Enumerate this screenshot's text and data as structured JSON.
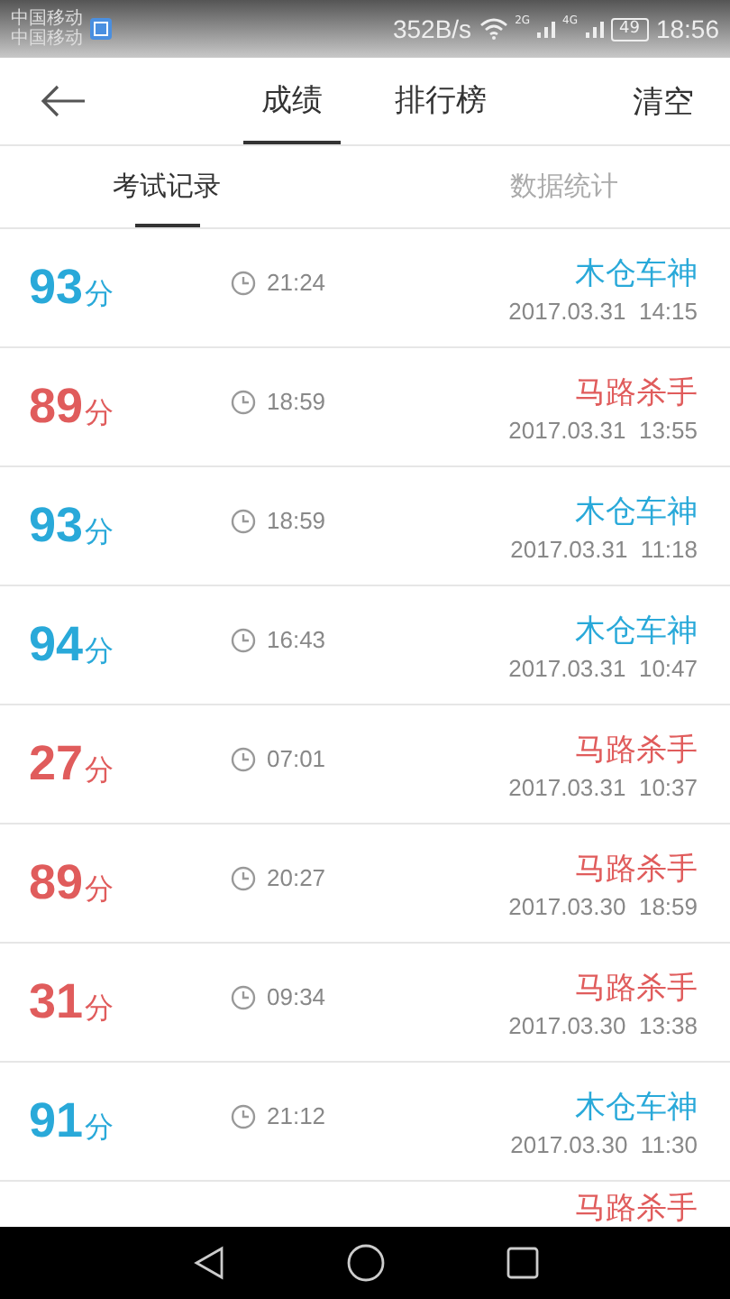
{
  "status_bar": {
    "carrier_1": "中国移动",
    "carrier_2": "中国移动",
    "speed": "352B/s",
    "network_1": "2G",
    "network_2": "4G",
    "battery": "49",
    "time": "18:56"
  },
  "header": {
    "tabs": [
      {
        "label": "成绩",
        "selected": true
      },
      {
        "label": "排行榜",
        "selected": false
      }
    ],
    "action": "清空"
  },
  "subtabs": [
    {
      "label": "考试记录",
      "selected": true
    },
    {
      "label": "数据统计",
      "selected": false
    }
  ],
  "records": [
    {
      "score": "93",
      "unit": "分",
      "duration": "21:24",
      "title": "木仓车神",
      "date": "2017.03.31  14:15",
      "color": "#29a9d9"
    },
    {
      "score": "89",
      "unit": "分",
      "duration": "18:59",
      "title": "马路杀手",
      "date": "2017.03.31  13:55",
      "color": "#e05c5c"
    },
    {
      "score": "93",
      "unit": "分",
      "duration": "18:59",
      "title": "木仓车神",
      "date": "2017.03.31  11:18",
      "color": "#29a9d9"
    },
    {
      "score": "94",
      "unit": "分",
      "duration": "16:43",
      "title": "木仓车神",
      "date": "2017.03.31  10:47",
      "color": "#29a9d9"
    },
    {
      "score": "27",
      "unit": "分",
      "duration": "07:01",
      "title": "马路杀手",
      "date": "2017.03.31  10:37",
      "color": "#e05c5c"
    },
    {
      "score": "89",
      "unit": "分",
      "duration": "20:27",
      "title": "马路杀手",
      "date": "2017.03.30  18:59",
      "color": "#e05c5c"
    },
    {
      "score": "31",
      "unit": "分",
      "duration": "09:34",
      "title": "马路杀手",
      "date": "2017.03.30  13:38",
      "color": "#e05c5c"
    },
    {
      "score": "91",
      "unit": "分",
      "duration": "21:12",
      "title": "木仓车神",
      "date": "2017.03.30  11:30",
      "color": "#29a9d9"
    }
  ],
  "partial_record": {
    "title": "马路杀手",
    "color": "#e05c5c"
  }
}
